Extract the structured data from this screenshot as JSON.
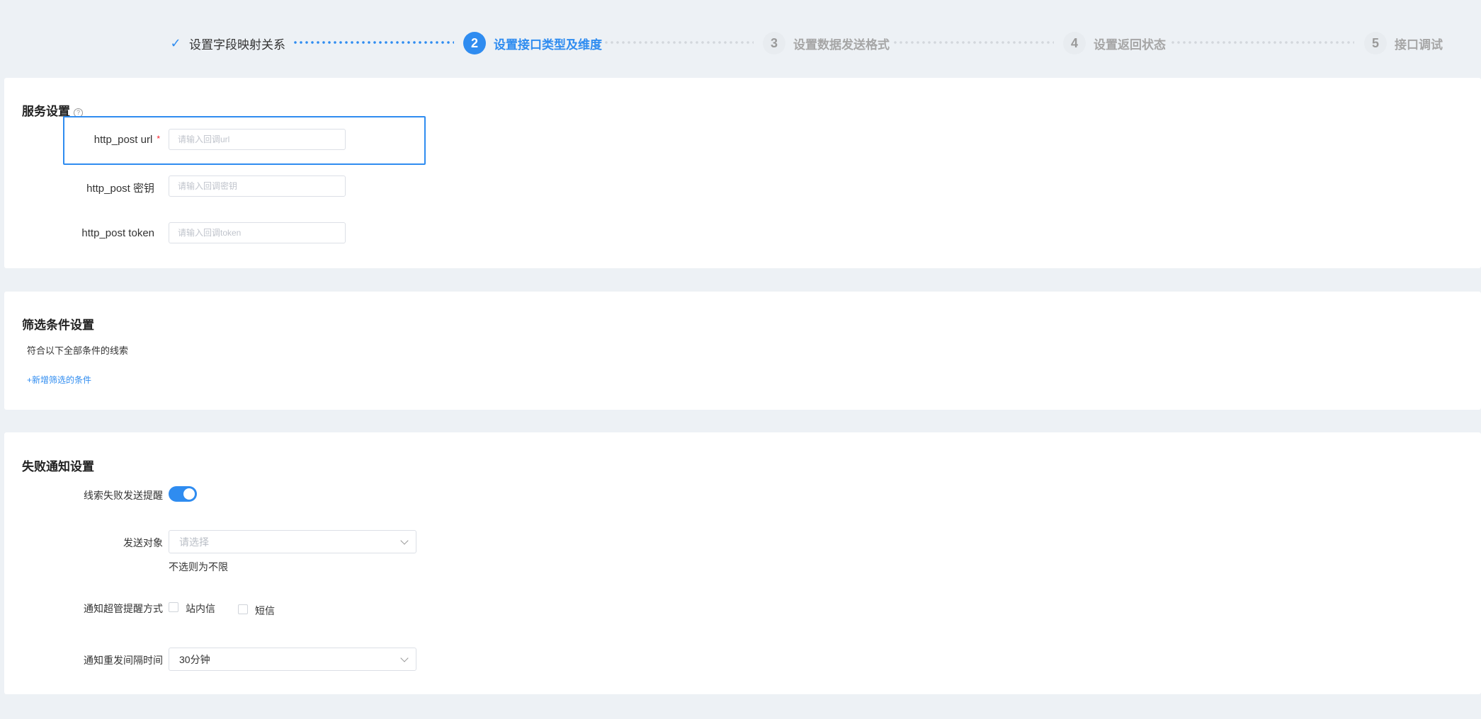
{
  "steps": [
    {
      "number": "",
      "label": "设置字段映射关系",
      "status": "done"
    },
    {
      "number": "2",
      "label": "设置接口类型及维度",
      "status": "active"
    },
    {
      "number": "3",
      "label": "设置数据发送格式",
      "status": "inactive"
    },
    {
      "number": "4",
      "label": "设置返回状态",
      "status": "inactive"
    },
    {
      "number": "5",
      "label": "接口调试",
      "status": "inactive"
    }
  ],
  "service": {
    "title": "服务设置",
    "fields": [
      {
        "label": "http_post url",
        "placeholder": "请输入回调url",
        "required": true
      },
      {
        "label": "http_post 密钥",
        "placeholder": "请输入回调密钥",
        "required": false
      },
      {
        "label": "http_post token",
        "placeholder": "请输入回调token",
        "required": false
      }
    ]
  },
  "filter": {
    "title": "筛选条件设置",
    "description": "符合以下全部条件的线索",
    "add_link": "+新增筛选的条件"
  },
  "failure": {
    "title": "失败通知设置",
    "toggle_label": "线索失败发送提醒",
    "toggle_on": true,
    "send_target_label": "发送对象",
    "send_target_placeholder": "请选择",
    "send_target_hint": "不选则为不限",
    "method_label": "通知超管提醒方式",
    "methods": [
      {
        "label": "站内信",
        "checked": false
      },
      {
        "label": "短信",
        "checked": false
      }
    ],
    "interval_label": "通知重发间隔时间",
    "interval_value": "30分钟"
  },
  "colors": {
    "accent": "#2f8cf0",
    "background": "#edf1f5",
    "required": "#f5222d"
  }
}
